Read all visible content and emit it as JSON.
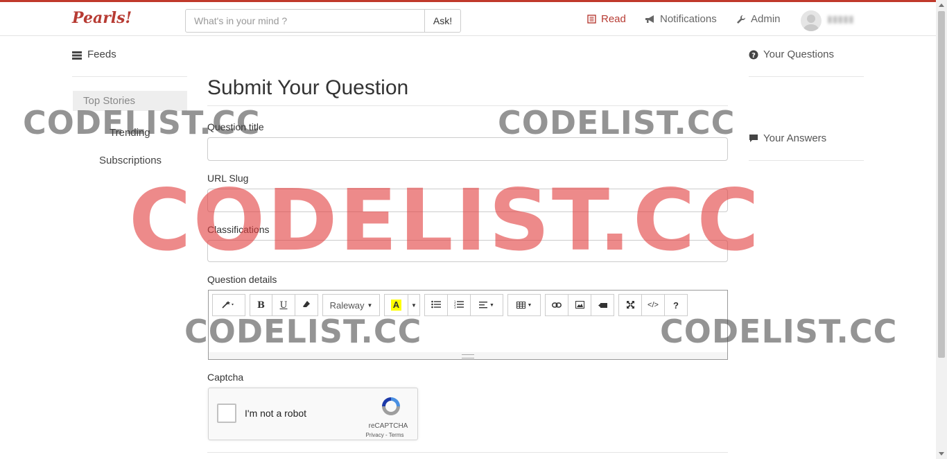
{
  "brand": "Pearls!",
  "search": {
    "placeholder": "What's in your mind ?",
    "button": "Ask!"
  },
  "nav": [
    {
      "label": "Read",
      "icon": "book-icon",
      "active": true
    },
    {
      "label": "Notifications",
      "icon": "bullhorn-icon",
      "active": false
    },
    {
      "label": "Admin",
      "icon": "wrench-icon",
      "active": false
    }
  ],
  "left_sidebar": {
    "title": "Feeds",
    "items": [
      "Top Stories",
      "Trending",
      "Subscriptions"
    ]
  },
  "right_sidebar": {
    "questions": "Your Questions",
    "answers": "Your Answers"
  },
  "form": {
    "heading": "Submit Your Question",
    "question_title_label": "Question title",
    "slug_label": "URL Slug",
    "classifications_label": "Classifications",
    "details_label": "Question details",
    "captcha_label": "Captcha"
  },
  "editor_toolbar": {
    "font": "Raleway",
    "help": "?"
  },
  "recaptcha": {
    "label": "I'm not a robot",
    "brand": "reCAPTCHA",
    "terms": "Privacy - Terms"
  },
  "watermark": "CODELIST.CC",
  "colors": {
    "accent": "#b73b33",
    "highlight": "#ffff00"
  }
}
